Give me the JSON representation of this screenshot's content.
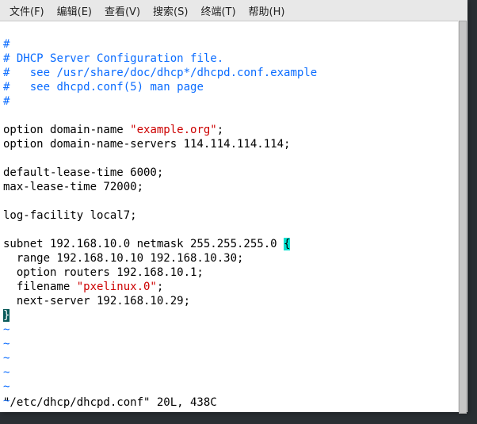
{
  "menubar": {
    "items": [
      {
        "label": "文件(F)"
      },
      {
        "label": "编辑(E)"
      },
      {
        "label": "查看(V)"
      },
      {
        "label": "搜索(S)"
      },
      {
        "label": "终端(T)"
      },
      {
        "label": "帮助(H)"
      }
    ]
  },
  "editor": {
    "lines": {
      "l0": {
        "hash": "#"
      },
      "l1": {
        "hash": "#",
        "rest": " DHCP Server Configuration file."
      },
      "l2": {
        "hash": "#",
        "rest": "   see /usr/share/doc/dhcp*/dhcpd.conf.example"
      },
      "l3": {
        "hash": "#",
        "rest": "   see dhcpd.conf(5) man page"
      },
      "l4": {
        "hash": "#"
      },
      "l5": {
        "a": "option domain-name ",
        "q": "\"example.org\"",
        "b": ";"
      },
      "l6": {
        "text": "option domain-name-servers 114.114.114.114;"
      },
      "l7": {
        "text": "default-lease-time 6000;"
      },
      "l8": {
        "text": "max-lease-time 72000;"
      },
      "l9": {
        "text": "log-facility local7;"
      },
      "l10": {
        "a": "subnet 192.168.10.0 netmask 255.255.255.0 ",
        "brace": "{"
      },
      "l11": {
        "text": "  range 192.168.10.10 192.168.10.30;"
      },
      "l12": {
        "text": "  option routers 192.168.10.1;"
      },
      "l13": {
        "a": "  filename ",
        "q": "\"pxelinux.0\"",
        "b": ";"
      },
      "l14": {
        "text": "  next-server 192.168.10.29;"
      },
      "l15": {
        "brace": "}"
      }
    },
    "tilde": "~"
  },
  "status": {
    "text": "\"/etc/dhcp/dhcpd.conf\" 20L, 438C"
  },
  "chart_data": null
}
